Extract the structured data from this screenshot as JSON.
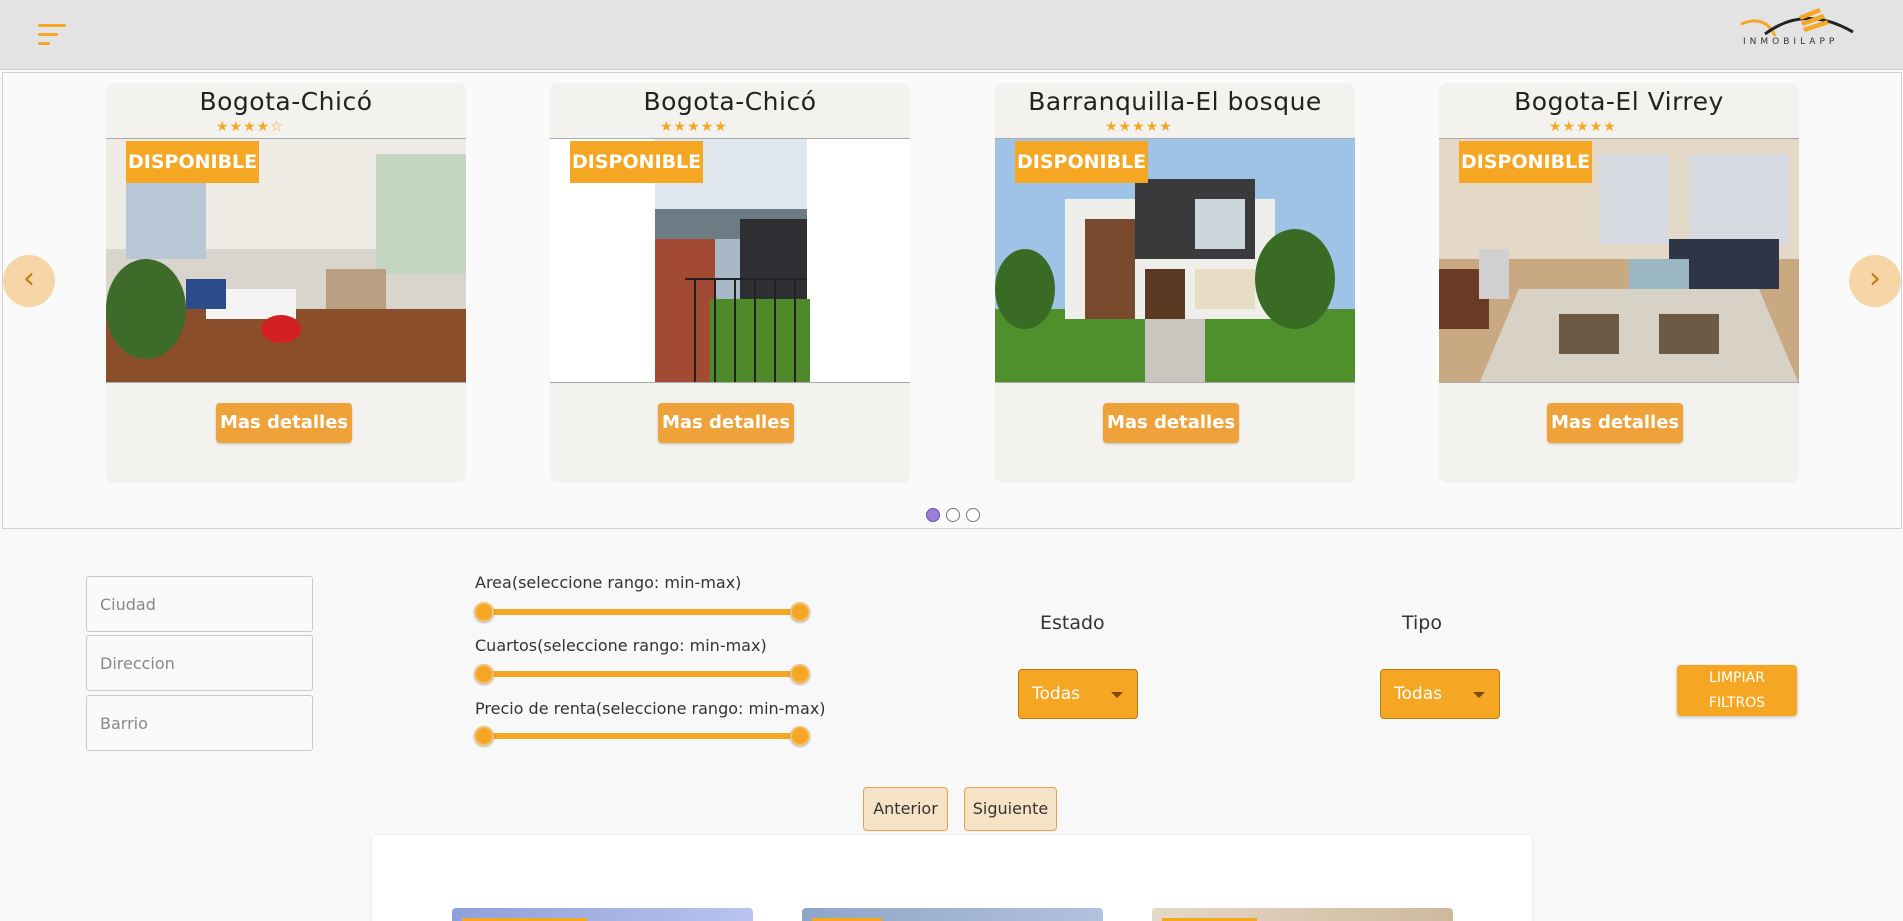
{
  "header": {
    "menu_icon": "hamburger-menu-icon",
    "logo_text": "INMOBILAPP",
    "brand_color": "#f5a623"
  },
  "carousel": {
    "prev_label": "‹",
    "next_label": "›",
    "active_page": 1,
    "page_count": 3,
    "cards": [
      {
        "title": "Bogota-Chicó",
        "rating": 4,
        "stars": "★★★★☆",
        "badge": "DISPONIBLE",
        "button": "Mas detalles"
      },
      {
        "title": "Bogota-Chicó",
        "rating": 5,
        "stars": "★★★★★",
        "badge": "DISPONIBLE",
        "button": "Mas detalles"
      },
      {
        "title": "Barranquilla-El bosque",
        "rating": 5,
        "stars": "★★★★★",
        "badge": "DISPONIBLE",
        "button": "Mas detalles"
      },
      {
        "title": "Bogota-El Virrey",
        "rating": 5,
        "stars": "★★★★★",
        "badge": "DISPONIBLE",
        "button": "Mas detalles"
      }
    ]
  },
  "filters": {
    "ciudad_placeholder": "Ciudad",
    "direccion_placeholder": "Direccion",
    "barrio_placeholder": "Barrio",
    "area_label": "Area(seleccione rango: min-max)",
    "cuartos_label": "Cuartos(seleccione rango: min-max)",
    "precio_label": "Precio de renta(seleccione rango: min-max)",
    "estado_label": "Estado",
    "estado_value": "Todas",
    "tipo_label": "Tipo",
    "tipo_value": "Todas",
    "clear_label_line1": "LIMPIAR",
    "clear_label_line2": "FILTROS"
  },
  "pagination": {
    "prev_label": "Anterior",
    "next_label": "Siguiente"
  }
}
